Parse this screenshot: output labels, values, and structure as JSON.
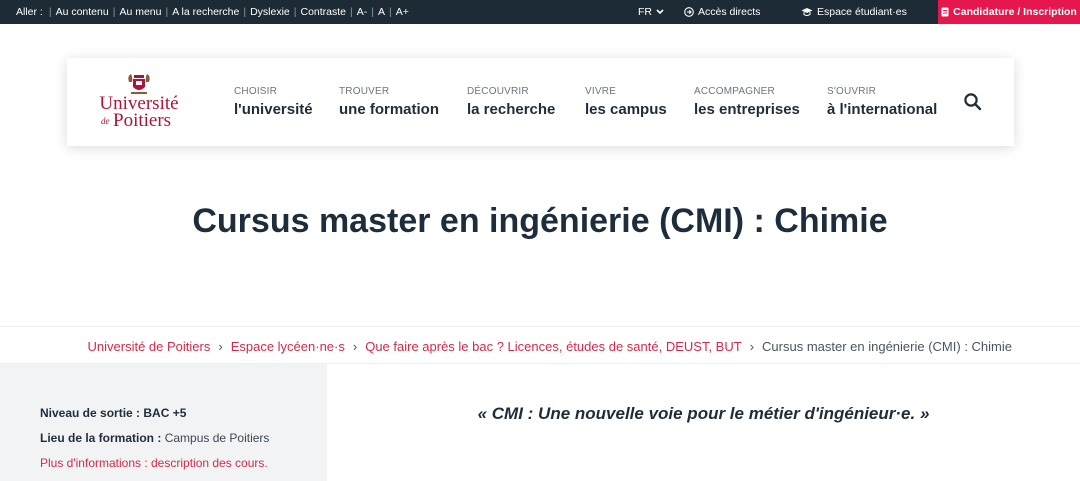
{
  "topbar": {
    "access_label": "Aller :",
    "access_links": [
      "Au contenu",
      "Au menu",
      "A la recherche",
      "Dyslexie",
      "Contraste",
      "A-",
      "A",
      "A+"
    ],
    "language": "FR",
    "direct_access": "Accès directs",
    "student_space": "Espace étudiant·es",
    "apply": "Candidature / Inscription"
  },
  "logo": {
    "line1": "Université",
    "line2_prefix": "de",
    "line2": "Poitiers"
  },
  "nav": [
    {
      "small": "CHOISIR",
      "big": "l'université"
    },
    {
      "small": "TROUVER",
      "big": "une formation"
    },
    {
      "small": "DÉCOUVRIR",
      "big": "la recherche"
    },
    {
      "small": "VIVRE",
      "big": "les campus"
    },
    {
      "small": "ACCOMPAGNER",
      "big": "les entreprises"
    },
    {
      "small": "S'OUVRIR",
      "big": "à l'international"
    }
  ],
  "page": {
    "title": "Cursus master en ingénierie (CMI) : Chimie"
  },
  "breadcrumb": {
    "items": [
      "Université de Poitiers",
      "Espace lycéen·ne·s",
      "Que faire après le bac ? Licences, études de santé, DEUST, BUT"
    ],
    "current": "Cursus master en ingénierie (CMI) : Chimie"
  },
  "info": {
    "level_label": "Niveau de sortie : BAC +5",
    "location_label": "Lieu de la formation :",
    "location_value": "Campus de Poitiers",
    "more_link": "Plus d'informations : description des cours."
  },
  "quote": "« CMI : Une nouvelle voie pour le métier d'ingénieur·e. »",
  "colors": {
    "topbar": "#1d2b36",
    "accent": "#e5174d",
    "link": "#d42a4a",
    "logo": "#b0133a",
    "panel": "#f2f3f5"
  }
}
